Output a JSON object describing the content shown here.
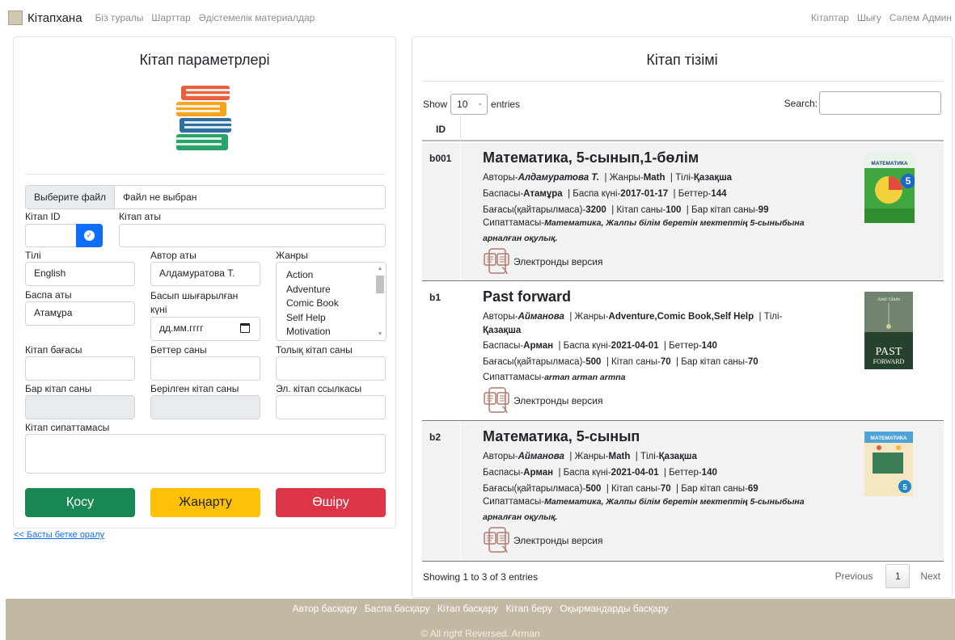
{
  "navbar": {
    "brand": "Кітапхана",
    "left_links": [
      "Біз туралы",
      "Шарттар",
      "Әдістемелік материалдар"
    ],
    "right_links": [
      "Кітаптар",
      "Шығу",
      "Сәлем Админ"
    ]
  },
  "form": {
    "title": "Кітап параметрлері",
    "file_button": "Выберите файл",
    "file_status": "Файл не выбран",
    "book_id_label": "Кітап ID",
    "book_id_value": "",
    "book_name_label": "Кітап аты",
    "book_name_value": "",
    "language_label": "Тілі",
    "language_value": "English",
    "author_label": "Автор аты",
    "author_value": "Алдамуратова Т.",
    "genres_label": "Жанры",
    "genres": [
      "Action",
      "Adventure",
      "Comic Book",
      "Self Help",
      "Motivation"
    ],
    "publisher_label": "Баспа аты",
    "publisher_value": "Атамұра",
    "pub_date_label": "Басып шығарылған күні",
    "pub_date_placeholder": "дд.мм.гггг",
    "price_label": "Кітап бағасы",
    "pages_label": "Беттер саны",
    "total_label": "Толық кітап саны",
    "available_label": "Бар кітап саны",
    "issued_label": "Берілген кітап саны",
    "elink_label": "Эл. кітап ссылкасы",
    "description_label": "Кітап сипаттамасы",
    "add_button": "Қосу",
    "update_button": "Жаңарту",
    "delete_button": "Өшіру",
    "back_link": "<< Басты бетке оралу"
  },
  "list": {
    "title": "Кітап тізімі",
    "show_label": "Show",
    "entries_value": "10",
    "entries_label": "entries",
    "search_label": "Search:",
    "column_id": "ID",
    "ebook_label": "Электронды версия",
    "books": [
      {
        "id": "b001",
        "title": "Математика, 5-сынып,1-бөлім",
        "author": "Алдамуратова Т.",
        "genre": "Math",
        "language": "Қазақша",
        "publisher": "Атамұра",
        "pub_date": "2017-01-17",
        "pages": "144",
        "price": "3200",
        "total": "100",
        "available": "99",
        "description_1": "Математика, Жалпы білім беретін мектептің 5-сыныбына",
        "description_2": "арналған оқулық."
      },
      {
        "id": "b1",
        "title": "Past forward",
        "author": "Айманова",
        "genre": "Adventure,Comic Book,Self Help",
        "language": "Қазақша",
        "publisher": "Арман",
        "pub_date": "2021-04-01",
        "pages": "140",
        "price": "500",
        "total": "70",
        "available": "70",
        "description_1": "arman arman armna"
      },
      {
        "id": "b2",
        "title": "Математика, 5-сынып",
        "author": "Айманова",
        "genre": "Math",
        "language": "Қазақша",
        "publisher": "Арман",
        "pub_date": "2021-04-01",
        "pages": "140",
        "price": "500",
        "total": "70",
        "available": "69",
        "description_1": "Математика, Жалпы білім беретін мектептің 5-сыныбына",
        "description_2": "арналған оқулық."
      }
    ],
    "labels": {
      "author": "Авторы-",
      "genre": "Жанры-",
      "language": "Тілі-",
      "publisher": "Баспасы-",
      "pub_date": "Баспа күні-",
      "pages": "Беттер-",
      "price": "Бағасы(қайтарылмаса)-",
      "total": "Кітап саны-",
      "available": "Бар кітап саны-",
      "description": "Сипаттамасы-"
    },
    "cover_texts": {
      "b001": "МАТЕМАТИКА",
      "b001_grade": "5",
      "b1_author": "Amit Ghule",
      "b1_title_1": "PAST",
      "b1_title_2": "FORWARD",
      "b2": "МАТЕМАТИКА",
      "b2_grade": "5"
    },
    "info": "Showing 1 to 3 of 3 entries",
    "prev": "Previous",
    "page": "1",
    "next": "Next"
  },
  "footer": {
    "links": [
      "Автор басқару",
      "Баспа басқару",
      "Кітап басқару",
      "Кітап беру",
      "Оқырмандарды басқару"
    ],
    "copyright": "© All right Reversed. Arman"
  },
  "colors": {
    "primary": "#0d6efd",
    "success": "#198754",
    "warning": "#ffc107",
    "danger": "#dc3545",
    "footer": "#c2b8a3"
  }
}
